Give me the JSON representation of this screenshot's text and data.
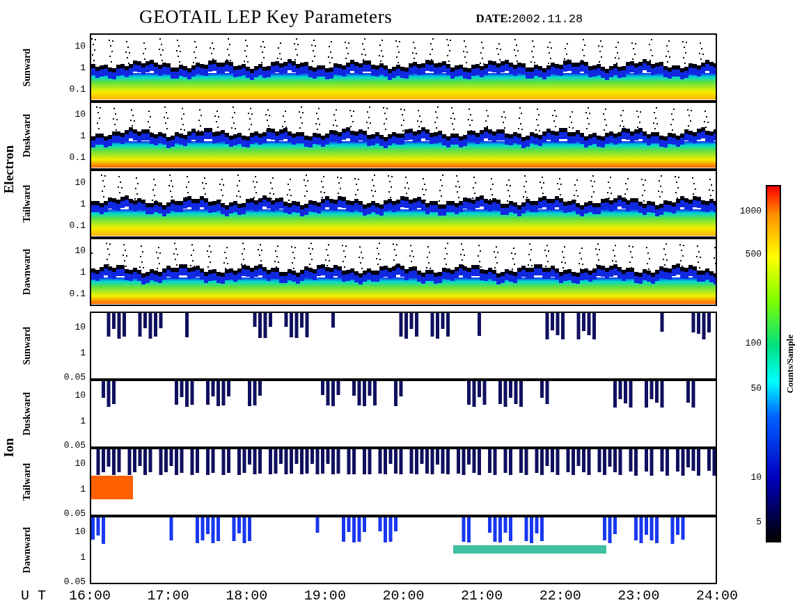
{
  "title": "GEOTAIL LEP Key Parameters",
  "date": {
    "label": "DATE:",
    "value": "2002.11.28"
  },
  "groups": [
    {
      "label": "Electron",
      "panels": [
        {
          "label": "Sunward",
          "kind": "electron",
          "ticks": [
            "10",
            "1",
            "0.1"
          ]
        },
        {
          "label": "Duskward",
          "kind": "electron",
          "ticks": [
            "10",
            "1",
            "0.1"
          ]
        },
        {
          "label": "Tailward",
          "kind": "electron",
          "ticks": [
            "10",
            "1",
            "0.1"
          ]
        },
        {
          "label": "Dawnward",
          "kind": "electron",
          "ticks": [
            "10",
            "1",
            "0.1"
          ]
        }
      ]
    },
    {
      "label": "Ion",
      "panels": [
        {
          "label": "Sunward",
          "kind": "ion",
          "ticks": [
            "10",
            "1",
            "0.05"
          ]
        },
        {
          "label": "Duskward",
          "kind": "ion",
          "ticks": [
            "10",
            "1",
            "0.05"
          ]
        },
        {
          "label": "Tailward",
          "kind": "ion",
          "ticks": [
            "10",
            "1",
            "0.05"
          ]
        },
        {
          "label": "Dawnward",
          "kind": "ion",
          "ticks": [
            "10",
            "1",
            "0.05"
          ]
        }
      ]
    }
  ],
  "time_axis": {
    "label": "U T",
    "ticks": [
      "16:00",
      "17:00",
      "18:00",
      "19:00",
      "20:00",
      "21:00",
      "22:00",
      "23:00",
      "24:00"
    ]
  },
  "colorbar": {
    "label": "Counts/Sample",
    "ticks": [
      "1000",
      "500",
      "100",
      "50",
      "10",
      "5"
    ]
  }
}
